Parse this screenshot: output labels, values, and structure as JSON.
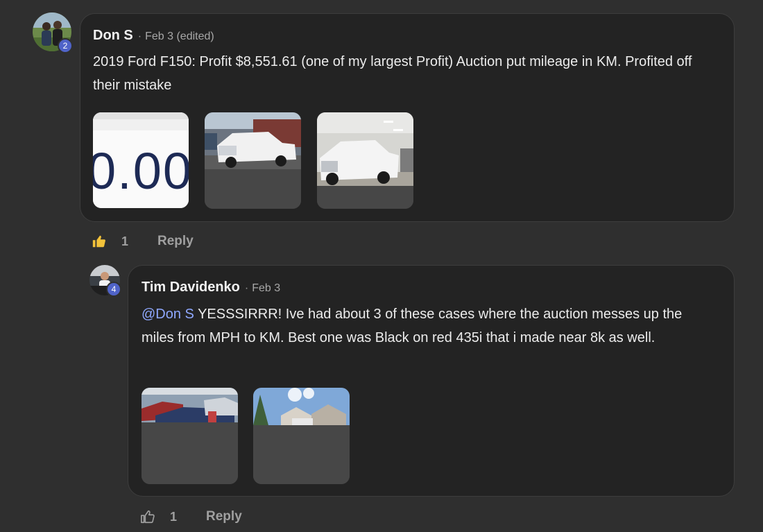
{
  "comments": [
    {
      "author": "Don S",
      "date": "Feb 3 (edited)",
      "level": "2",
      "text": "2019 Ford F150: Profit $8,551.61 (one of my largest Profit) Auction put mileage in KM. Profited off their mistake",
      "attachments": [
        "image-odometer-crop",
        "image-white-truck-lot",
        "image-white-truck-garage"
      ],
      "likes": "1",
      "liked": true,
      "reply_label": "Reply",
      "like_color": "#f2c23a"
    },
    {
      "author": "Tim Davidenko",
      "date": "Feb 3",
      "level": "4",
      "mention": "@Don S",
      "text": "YESSSIRRR! Ive had about 3 of these cases where the auction messes up the miles from MPH to KM. Best one was Black on red 435i that i made near 8k as well.",
      "attachments": [
        "image-car-lot",
        "image-house-street"
      ],
      "likes": "1",
      "liked": false,
      "reply_label": "Reply",
      "mention_color": "#8fa8ff"
    }
  ],
  "image_crop_text": "0.00",
  "theme": {
    "background": "#2f2f2f",
    "bubble": "#232323",
    "badge": "#4f63c8"
  }
}
